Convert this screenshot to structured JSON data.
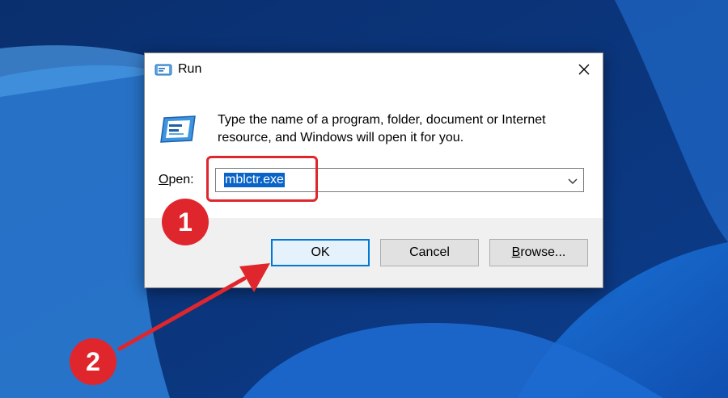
{
  "dialog": {
    "title": "Run",
    "description": "Type the name of a program, folder, document or Internet resource, and Windows will open it for you.",
    "open_label_mnemonic": "O",
    "open_label_rest": "pen:",
    "open_value": "mblctr.exe",
    "buttons": {
      "ok": "OK",
      "cancel": "Cancel",
      "browse_mnemonic": "B",
      "browse_rest": "rowse..."
    }
  },
  "annotations": {
    "step1": "1",
    "step2": "2",
    "color": "#e0262d"
  },
  "icons": {
    "title": "run-icon",
    "close": "close-icon",
    "dropdown": "chevron-down-icon"
  }
}
